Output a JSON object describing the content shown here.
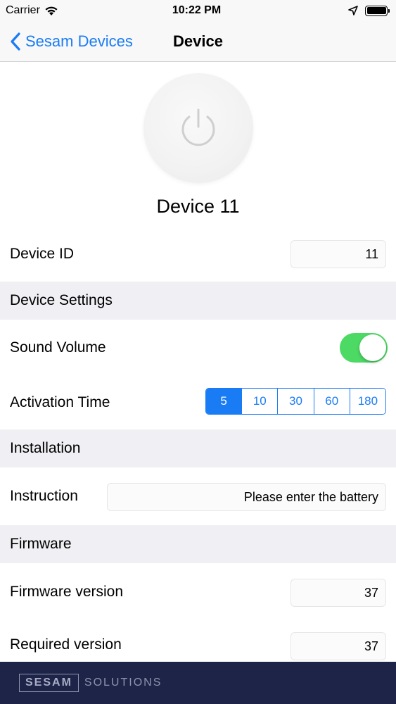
{
  "status_bar": {
    "carrier": "Carrier",
    "time": "10:22 PM"
  },
  "nav": {
    "back_label": "Sesam Devices",
    "title": "Device"
  },
  "device": {
    "name": "Device 11",
    "id_label": "Device ID",
    "id_value": "11"
  },
  "sections": {
    "device_settings": "Device Settings",
    "installation": "Installation",
    "firmware": "Firmware"
  },
  "settings": {
    "sound_volume_label": "Sound Volume",
    "sound_volume_on": true,
    "activation_time_label": "Activation Time",
    "activation_options": [
      "5",
      "10",
      "30",
      "60",
      "180"
    ],
    "activation_selected": "5"
  },
  "installation": {
    "instruction_label": "Instruction",
    "instruction_value": "Please enter the battery"
  },
  "firmware": {
    "version_label": "Firmware version",
    "version_value": "37",
    "required_label": "Required version",
    "required_value": "37"
  },
  "footer": {
    "logo_box": "SESAM",
    "logo_text": "SOLUTIONS"
  },
  "colors": {
    "accent": "#1a7cf5",
    "toggle_on": "#4cd964",
    "section_bg": "#efeff4",
    "footer_bg": "#1e2448"
  }
}
